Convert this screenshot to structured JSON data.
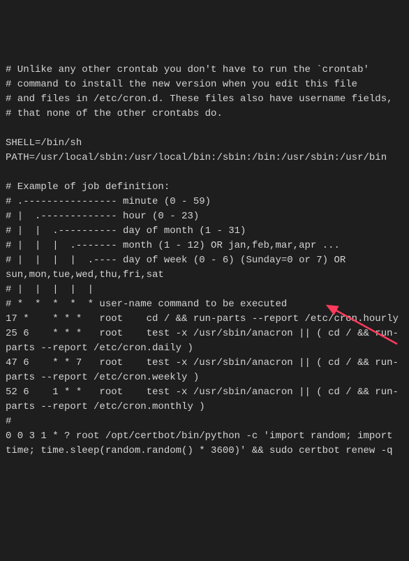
{
  "lines": {
    "l1": "# Unlike any other crontab you don't have to run the `crontab'",
    "l2": "# command to install the new version when you edit this file",
    "l3": "# and files in /etc/cron.d. These files also have username fields,",
    "l4": "# that none of the other crontabs do.",
    "l5": "",
    "l6": "SHELL=/bin/sh",
    "l7": "PATH=/usr/local/sbin:/usr/local/bin:/sbin:/bin:/usr/sbin:/usr/bin",
    "l8": "",
    "l9": "# Example of job definition:",
    "l10": "# .---------------- minute (0 - 59)",
    "l11": "# |  .------------- hour (0 - 23)",
    "l12": "# |  |  .---------- day of month (1 - 31)",
    "l13": "# |  |  |  .------- month (1 - 12) OR jan,feb,mar,apr ...",
    "l14": "# |  |  |  |  .---- day of week (0 - 6) (Sunday=0 or 7) OR sun,mon,tue,wed,thu,fri,sat",
    "l15": "# |  |  |  |  |",
    "l16": "# *  *  *  *  * user-name command to be executed",
    "l17": "17 *    * * *   root    cd / && run-parts --report /etc/cron.hourly",
    "l18": "25 6    * * *   root    test -x /usr/sbin/anacron || ( cd / && run-parts --report /etc/cron.daily )",
    "l19": "47 6    * * 7   root    test -x /usr/sbin/anacron || ( cd / && run-parts --report /etc/cron.weekly )",
    "l20": "52 6    1 * *   root    test -x /usr/sbin/anacron || ( cd / && run-parts --report /etc/cron.monthly )",
    "l21": "#",
    "l22": "0 0 3 1 * ? root /opt/certbot/bin/python -c 'import random; import time; time.sleep(random.random() * 3600)' && sudo certbot renew -q"
  }
}
